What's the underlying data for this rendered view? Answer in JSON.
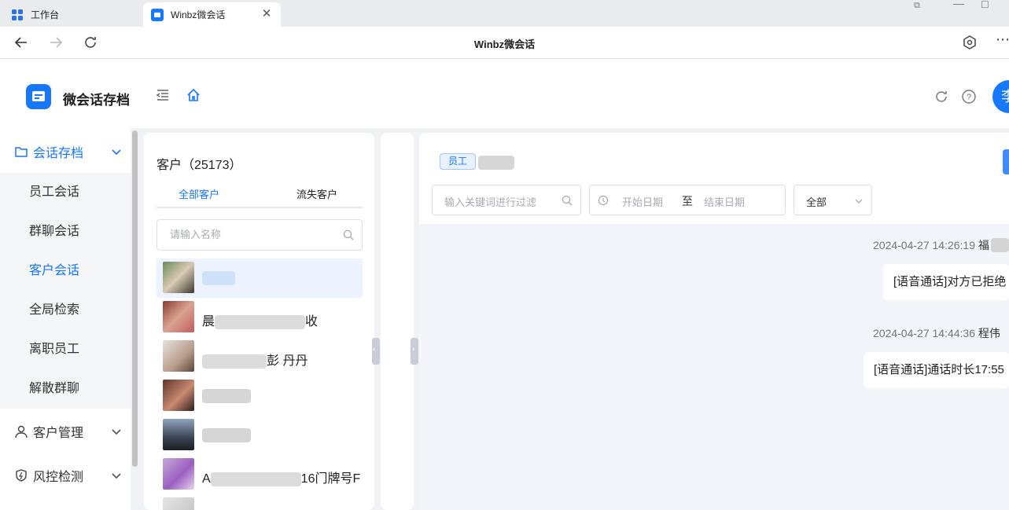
{
  "browser": {
    "tabs": [
      {
        "label": "工作台",
        "icon": "grid-apps-icon"
      },
      {
        "label": "Winbz微会话",
        "icon": "chat-app-icon",
        "active": true
      }
    ],
    "page_title": "Winbz微会话"
  },
  "app": {
    "title": "微会话存档",
    "user_avatar": "李"
  },
  "sidebar": {
    "groups": [
      {
        "label": "会话存档",
        "icon": "folder-icon",
        "expanded": true
      },
      {
        "label": "客户管理",
        "icon": "user-icon"
      },
      {
        "label": "风控检测",
        "icon": "shield-icon"
      }
    ],
    "items": [
      {
        "label": "员工会话"
      },
      {
        "label": "群聊会话"
      },
      {
        "label": "客户会话",
        "active": true
      },
      {
        "label": "全局检索"
      },
      {
        "label": "离职员工"
      },
      {
        "label": "解散群聊"
      }
    ]
  },
  "customers": {
    "title": "客户（25173）",
    "tabs": [
      {
        "label": "全部客户",
        "active": true
      },
      {
        "label": "流失客户"
      }
    ],
    "search_placeholder": "请输入名称",
    "list": [
      {
        "name_suffix": ""
      },
      {
        "name_prefix": "晨",
        "name_suffix": "收"
      },
      {
        "name_prefix": "",
        "name_suffix": "彭 丹丹"
      },
      {
        "name_suffix": ""
      },
      {
        "name_suffix": ""
      },
      {
        "name_prefix": "A",
        "name_suffix": "16门牌号F"
      },
      {
        "name_suffix": ""
      }
    ]
  },
  "chat": {
    "tag": "员工",
    "filter": {
      "keyword_placeholder": "输入关键词进行过滤",
      "start_placeholder": "开始日期",
      "separator": "至",
      "end_placeholder": "结束日期",
      "type_value": "全部"
    },
    "messages": [
      {
        "time": "2024-04-27 14:26:19",
        "sender": "福",
        "text": "[语音通话]对方已拒绝"
      },
      {
        "time": "2024-04-27 14:44:36",
        "sender": "程伟",
        "text": "[语音通话]通话时长17:55"
      }
    ]
  },
  "colors": {
    "accent": "#1677ff",
    "active_bg": "#ecf3ff",
    "workspace_bg": "#f0f2f5"
  }
}
